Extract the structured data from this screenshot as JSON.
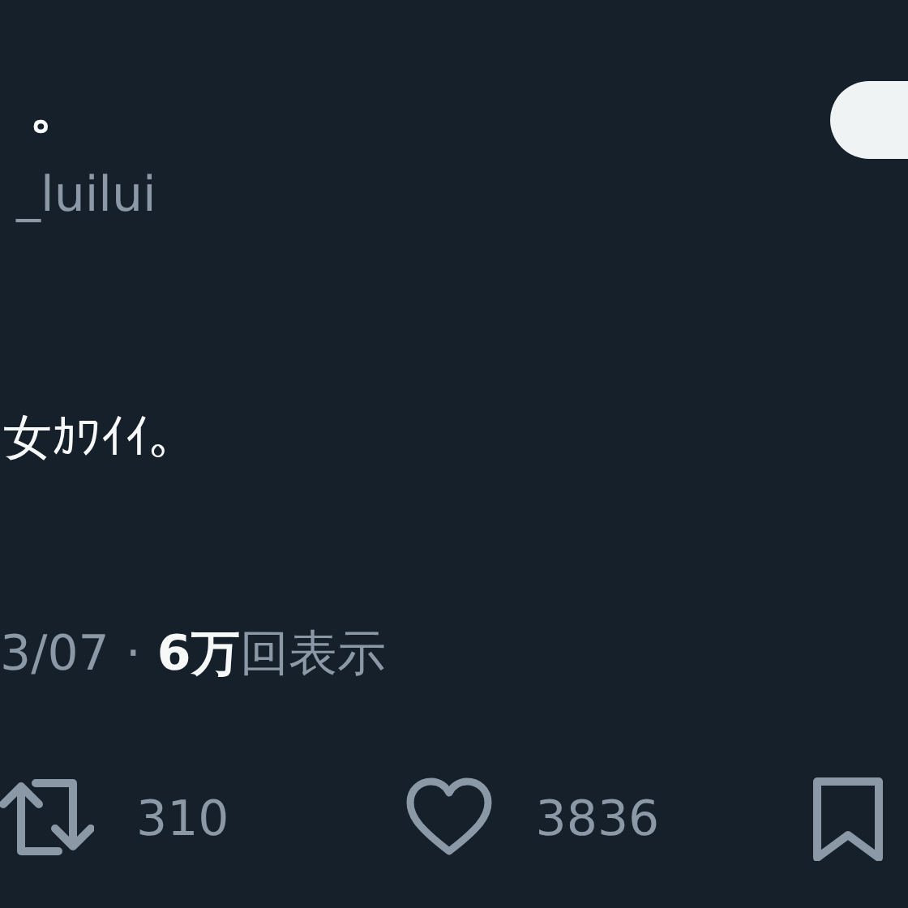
{
  "author": {
    "name_tail": "。",
    "handle_tail": "_luilui"
  },
  "follow_button": {
    "visible": true
  },
  "tweet": {
    "text_tail": "女ｶﾜｲｲ。"
  },
  "meta": {
    "date_tail": "3/07",
    "separator": "·",
    "views_count": "6万",
    "views_label": "回表示"
  },
  "actions": [
    {
      "kind": "retweet",
      "count": "310"
    },
    {
      "kind": "like",
      "count": "3836"
    },
    {
      "kind": "bookmark"
    }
  ]
}
